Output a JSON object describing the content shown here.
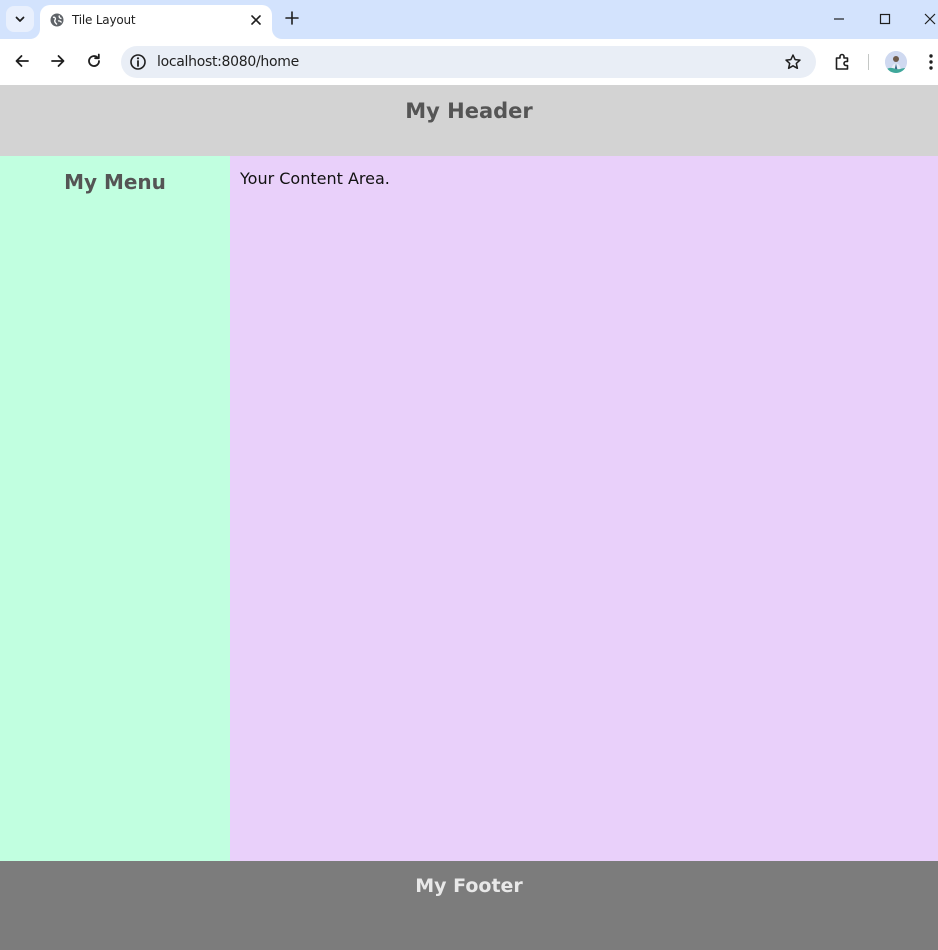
{
  "browser": {
    "tab": {
      "title": "Tile Layout"
    },
    "omnibox": {
      "url": "localhost:8080/home"
    }
  },
  "page": {
    "header": "My Header",
    "menu": "My Menu",
    "content": "Your Content Area.",
    "footer": "My Footer"
  },
  "colors": {
    "tabbar_bg": "#d3e3fd",
    "header_bg": "#d3d3d3",
    "menu_bg": "#c1ffe0",
    "content_bg": "#e9d0fa",
    "footer_bg": "#7c7c7c"
  },
  "icons": {
    "tab_search": "chevron-down-icon",
    "favicon": "globe-icon",
    "tab_close": "close-icon",
    "new_tab": "plus-icon",
    "minimize": "minimize-icon",
    "maximize": "maximize-icon",
    "close_window": "close-icon",
    "back": "arrow-left-icon",
    "forward": "arrow-right-icon",
    "reload": "reload-icon",
    "site_info": "info-icon",
    "bookmark": "star-icon",
    "extensions": "puzzle-icon",
    "profile": "avatar",
    "menu": "kebab-menu-icon"
  }
}
